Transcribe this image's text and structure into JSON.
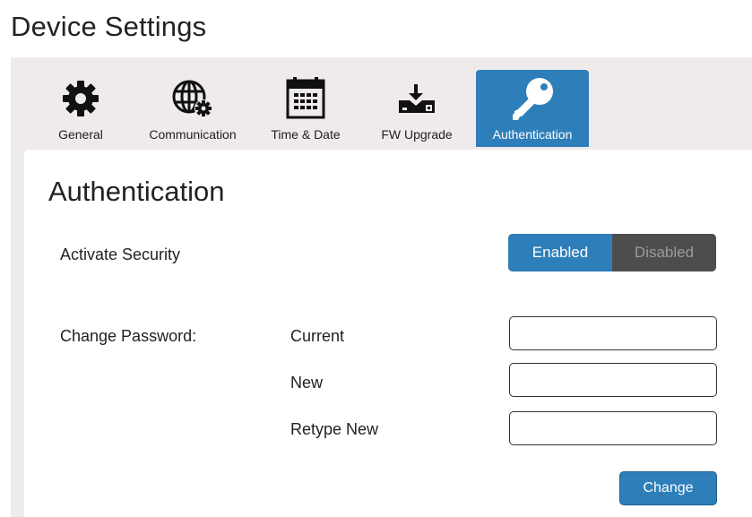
{
  "page": {
    "title": "Device Settings"
  },
  "tabs": [
    {
      "label": "General",
      "icon": "gear-icon",
      "active": false
    },
    {
      "label": "Communication",
      "icon": "globe-gear-icon",
      "active": false
    },
    {
      "label": "Time & Date",
      "icon": "calendar-icon",
      "active": false
    },
    {
      "label": "FW Upgrade",
      "icon": "firmware-upload-icon",
      "active": false
    },
    {
      "label": "Authentication",
      "icon": "key-icon",
      "active": true
    }
  ],
  "panel": {
    "title": "Authentication",
    "activate_security": {
      "label": "Activate Security",
      "enabled_label": "Enabled",
      "disabled_label": "Disabled",
      "selected": "Enabled"
    },
    "change_password": {
      "label": "Change Password:",
      "current_label": "Current",
      "current_value": "",
      "new_label": "New",
      "new_value": "",
      "retype_label": "Retype New",
      "retype_value": "",
      "button_label": "Change"
    }
  },
  "colors": {
    "accent": "#2e7fb9",
    "tab_bar_bg": "#efebea",
    "toggle_off_bg": "#4d4d4d"
  }
}
